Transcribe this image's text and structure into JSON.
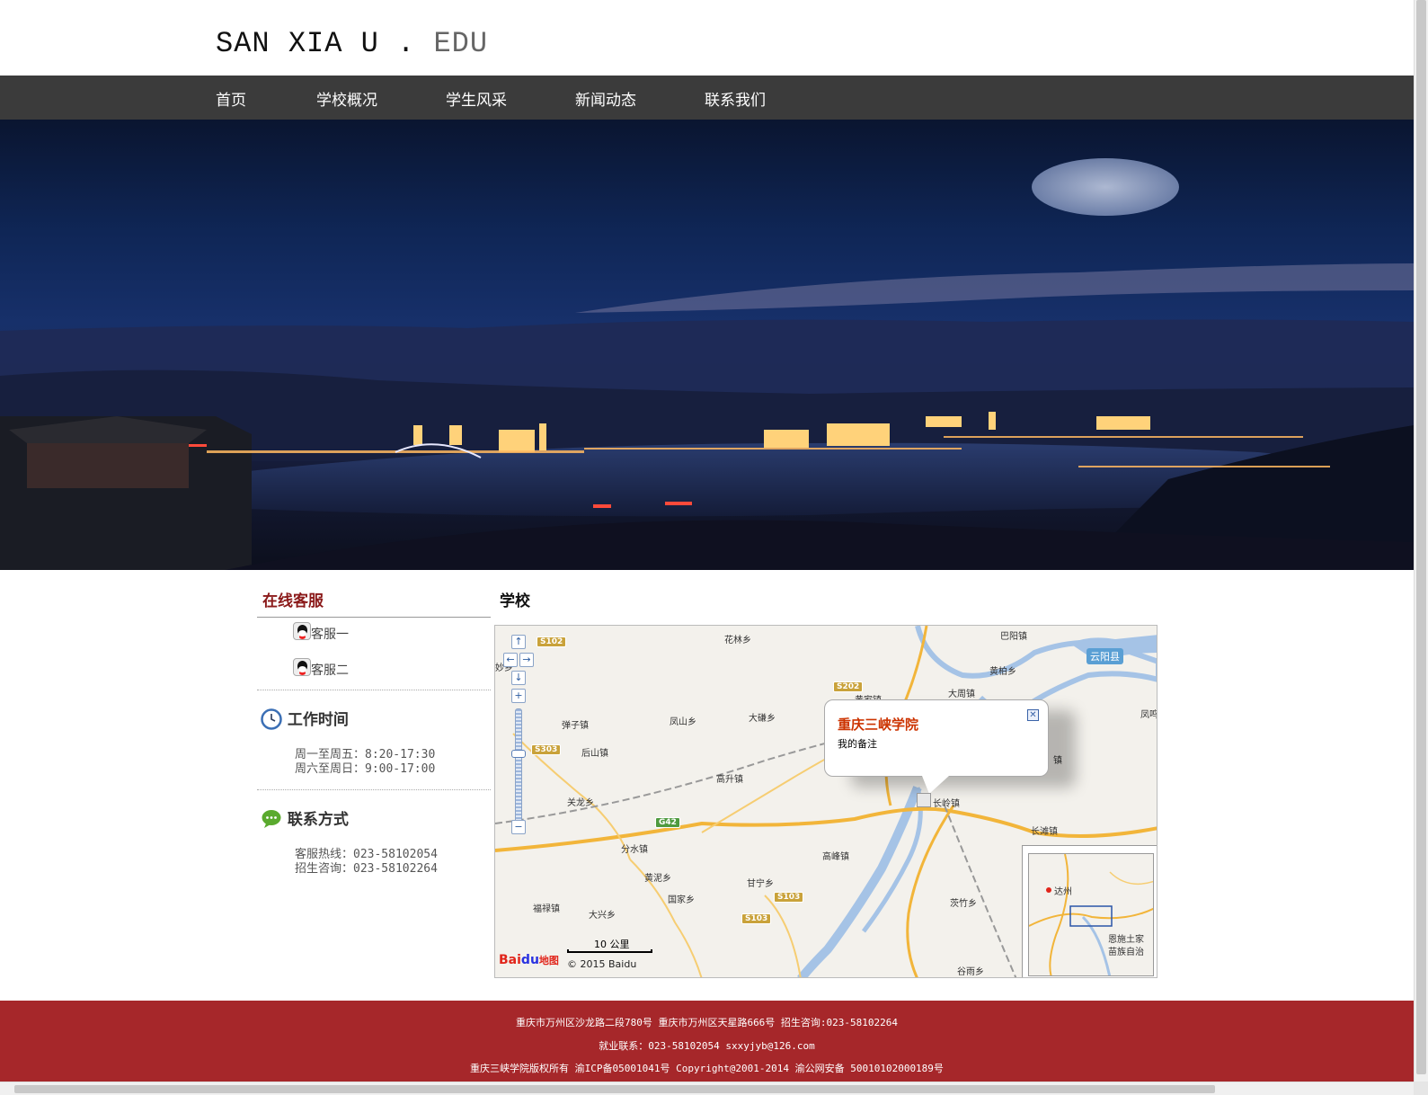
{
  "header": {
    "logo_main": "SAN XIA U . ",
    "logo_edu": "EDU"
  },
  "nav": {
    "items": [
      "首页",
      "学校概况",
      "学生风采",
      "新闻动态",
      "联系我们"
    ]
  },
  "hero": {
    "image_icon": "city-night-photo"
  },
  "sidebar": {
    "title": "在线客服",
    "qq_icon": "qq-penguin-icon",
    "service": [
      "客服一",
      "客服二"
    ],
    "work_hours": {
      "icon": "clock-icon",
      "title": "工作时间",
      "lines": [
        "周一至周五：8:20-17:30",
        "周六至周日：9:00-17:00"
      ]
    },
    "contact": {
      "icon": "chat-bubble-icon",
      "title": "联系方式",
      "lines": [
        "客服热线：023-58102054",
        "招生咨询：023-58102264"
      ]
    }
  },
  "school": {
    "title": "学校"
  },
  "map": {
    "zoom_in": "+",
    "zoom_out": "−",
    "pan_up": "↑",
    "pan_left": "←",
    "pan_right": "→",
    "pan_down": "↓",
    "places": [
      "花林乡",
      "巴阳镇",
      "黄柏乡",
      "大周镇",
      "凤鸣",
      "弹子镇",
      "凤山乡",
      "大磏乡",
      "后山镇",
      "高升镇",
      "关龙乡",
      "长岭镇",
      "长滩镇",
      "分水镇",
      "高峰镇",
      "黄泥乡",
      "甘宁乡",
      "国家乡",
      "福禄镇",
      "大兴乡",
      "茨竹乡",
      "谷雨乡",
      "妙乡",
      "黄家镇",
      "镇"
    ],
    "city": "云阳县",
    "roads": [
      "S102",
      "S202",
      "S303",
      "G42",
      "S103",
      "S103"
    ],
    "popup": {
      "title": "重庆三峡学院",
      "note": "我的备注",
      "close": "✕"
    },
    "overview": {
      "city": "达州",
      "label1": "恩施土家",
      "label2": "苗族自治"
    },
    "scale_label": "10 公里",
    "brand_bai": "Bai",
    "brand_du": "du",
    "brand_map": "地图",
    "copyright": "© 2015 Baidu"
  },
  "footer": {
    "line1": "重庆市万州区沙龙路二段780号 重庆市万州区天星路666号 招生咨询:023-58102264",
    "line2": "就业联系：023-58102054 sxxyjyb@126.com",
    "line3": "重庆三峡学院版权所有  渝ICP备05001041号 Copyright@2001-2014 渝公网安备 50010102000189号"
  },
  "colors": {
    "nav_bg": "#3b3b3b",
    "footer_bg": "#a6272a",
    "accent_red": "#8b1a1a",
    "popup_title": "#cc3300"
  }
}
